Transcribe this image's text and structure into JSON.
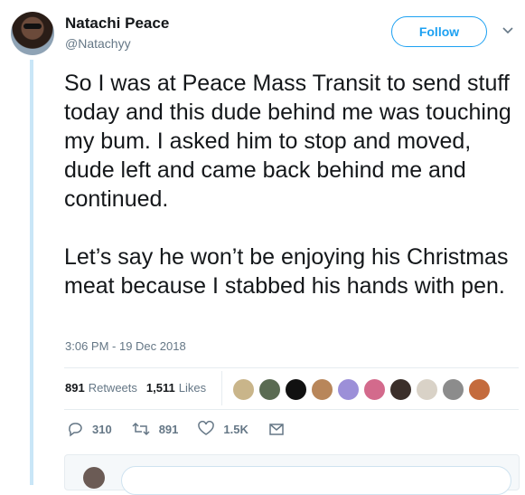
{
  "author": {
    "name": "Natachi Peace",
    "handle": "@Natachyy"
  },
  "follow_label": "Follow",
  "tweet": {
    "text": "So I was at Peace Mass Transit to send stuff today and this dude behind me was touching my bum. I asked him to stop and moved, dude left and came back behind me and continued.\n\nLet’s say he won’t be enjoying his Christmas meat because I stabbed his hands with pen.",
    "timestamp": "3:06 PM - 19 Dec 2018"
  },
  "stats": {
    "retweets_count": "891",
    "retweets_label": "Retweets",
    "likes_count": "1,511",
    "likes_label": "Likes"
  },
  "liker_avatar_colors": [
    "#c9b58a",
    "#5a6b52",
    "#111111",
    "#b8865a",
    "#9c8fd8",
    "#d36a8c",
    "#3b2f2a",
    "#d9d2c7",
    "#8c8c8c",
    "#c46b3d"
  ],
  "actions": {
    "reply_count": "310",
    "retweet_count": "891",
    "like_count": "1.5K"
  },
  "icons": [
    "caret-down-icon",
    "reply-icon",
    "retweet-icon",
    "heart-icon",
    "message-icon"
  ]
}
